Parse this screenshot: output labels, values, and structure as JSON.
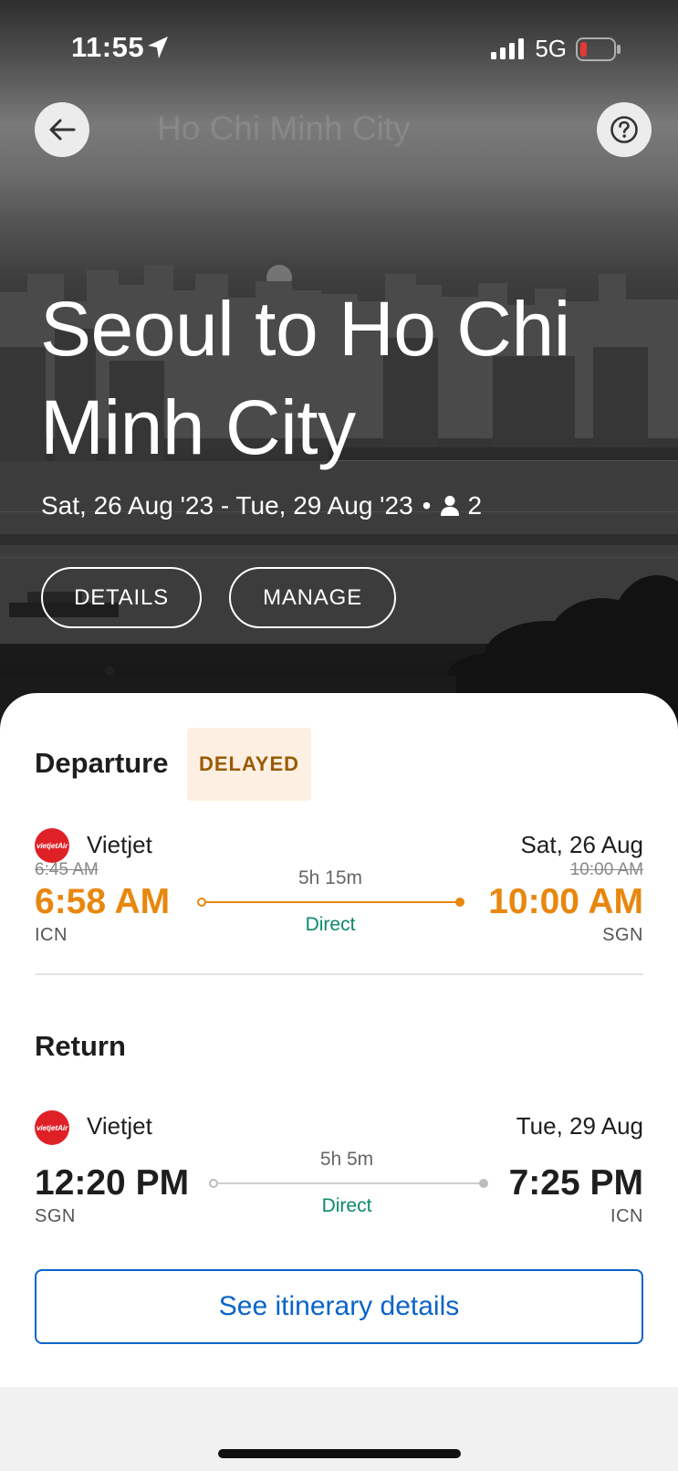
{
  "status_bar": {
    "time": "11:55",
    "network": "5G",
    "icons": [
      "location-arrow-icon",
      "signal-bars-icon",
      "battery-low-icon"
    ],
    "battery_color": "#e53935"
  },
  "header": {
    "faded_title": "Ho Chi Minh City",
    "back_icon": "arrow-left-icon",
    "help_icon": "question-circle-icon"
  },
  "trip": {
    "title": "Seoul to Ho Chi Minh City",
    "dates": "Sat, 26 Aug '23 - Tue, 29 Aug '23",
    "separator": "•",
    "passenger_icon": "person-icon",
    "passengers": "2",
    "buttons": {
      "details": "DETAILS",
      "manage": "MANAGE"
    }
  },
  "departure": {
    "section_title": "Departure",
    "status_badge": "DELAYED",
    "airline": "Vietjet",
    "airline_logo_text": "vietjetAir",
    "date": "Sat, 26 Aug",
    "original_depart_time": "6:45 AM",
    "depart_time": "6:58 AM",
    "depart_airport": "ICN",
    "duration": "5h 15m",
    "stops": "Direct",
    "original_arrive_time": "10:00 AM",
    "arrive_time": "10:00 AM",
    "arrive_airport": "SGN"
  },
  "return": {
    "section_title": "Return",
    "airline": "Vietjet",
    "airline_logo_text": "vietjetAir",
    "date": "Tue, 29 Aug",
    "depart_time": "12:20 PM",
    "depart_airport": "SGN",
    "duration": "5h 5m",
    "stops": "Direct",
    "arrive_time": "7:25 PM",
    "arrive_airport": "ICN"
  },
  "actions": {
    "itinerary_button": "See itinerary details"
  },
  "colors": {
    "delayed_text": "#9a5a05",
    "delayed_bg": "#fdf0e2",
    "delayed_time": "#e8870e",
    "direct": "#0b8a6a",
    "link_blue": "#0a64c8",
    "airline_red": "#e02027"
  }
}
